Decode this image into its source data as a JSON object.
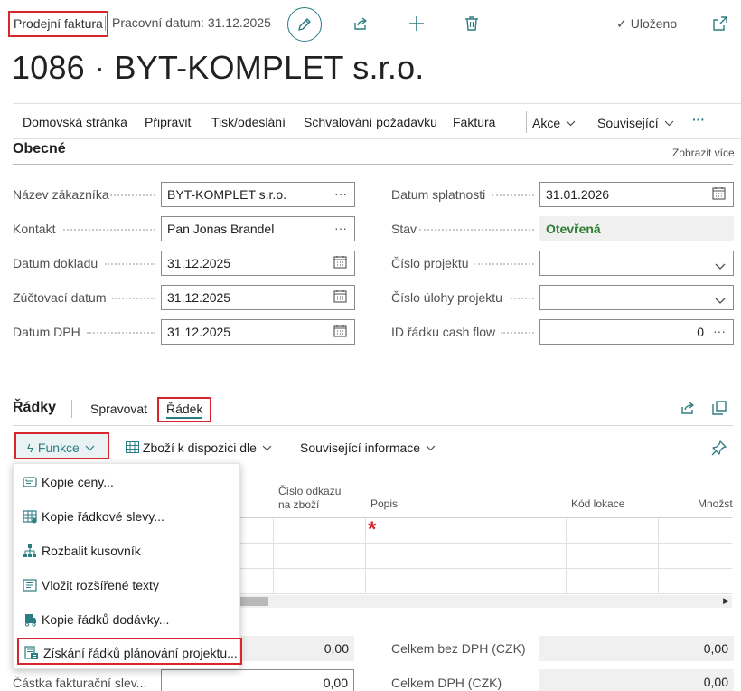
{
  "header": {
    "page_type": "Prodejní faktura",
    "work_date": "Pracovní datum: 31.12.2025",
    "saved_status": "Uloženo"
  },
  "title": "1086 · BYT-KOMPLET s.r.o.",
  "actions": {
    "home": "Domovská stránka",
    "prepare": "Připravit",
    "print_send": "Tisk/odeslání",
    "request_approval": "Schvalování požadavku",
    "invoice": "Faktura",
    "actions": "Akce",
    "related": "Související",
    "more": "···"
  },
  "general": {
    "title": "Obecné",
    "show_more": "Zobrazit více",
    "customer_name": {
      "label": "Název zákazníka",
      "value": "BYT-KOMPLET s.r.o."
    },
    "contact": {
      "label": "Kontakt",
      "value": "Pan Jonas Brandel"
    },
    "document_date": {
      "label": "Datum dokladu",
      "value": "31.12.2025"
    },
    "posting_date": {
      "label": "Zúčtovací datum",
      "value": "31.12.2025"
    },
    "vat_date": {
      "label": "Datum DPH",
      "value": "31.12.2025"
    },
    "due_date": {
      "label": "Datum splatnosti",
      "value": "31.01.2026"
    },
    "status": {
      "label": "Stav",
      "value": "Otevřená",
      "color": "#2f7d32"
    },
    "project_no": {
      "label": "Číslo projektu",
      "value": ""
    },
    "project_task_no": {
      "label": "Číslo úlohy projektu",
      "value": ""
    },
    "cash_flow_line_id": {
      "label": "ID řádku cash flow",
      "value": "0"
    }
  },
  "lines": {
    "title": "Řádky",
    "tabs": [
      "Spravovat",
      "Řádek"
    ],
    "functions_label": "Funkce",
    "item_availability": "Zboží k dispozici dle",
    "related_info": "Související informace",
    "columns": [
      "Číslo odkazu na zboží",
      "Popis",
      "Kód lokace",
      "Množst"
    ],
    "col_ref_line1": "Číslo odkazu",
    "col_ref_line2": "na zboží"
  },
  "functions_menu": [
    {
      "label": "Kopie ceny...",
      "icon": "price-list-icon"
    },
    {
      "label": "Kopie řádkové slevy...",
      "icon": "discount-grid-icon"
    },
    {
      "label": "Rozbalit kusovník",
      "icon": "bom-tree-icon"
    },
    {
      "label": "Vložit rozšířené texty",
      "icon": "text-list-icon"
    },
    {
      "label": "Kopie řádků dodávky...",
      "icon": "shipment-truck-icon"
    },
    {
      "label": "Získání řádků plánování projektu...",
      "icon": "project-planning-icon"
    }
  ],
  "totals": {
    "left_value_1": "0,00",
    "invoice_discount_label": "Částka fakturační slev...",
    "invoice_discount_value": "0,00",
    "total_excl_vat_label": "Celkem bez DPH (CZK)",
    "total_excl_vat_value": "0,00",
    "total_vat_label": "Celkem DPH (CZK)",
    "total_vat_value": "0,00"
  },
  "colors": {
    "accent": "#2b7c83",
    "highlight": "#d9262e",
    "status_green": "#2f7d32"
  }
}
